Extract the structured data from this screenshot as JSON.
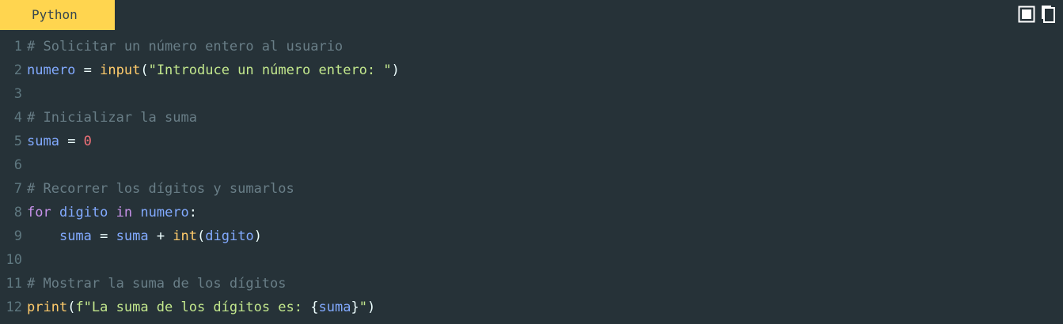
{
  "language_label": "Python",
  "toolbar": {
    "buttons": [
      {
        "name": "toggle-view-icon",
        "label": ""
      },
      {
        "name": "copy-icon",
        "label": ""
      }
    ]
  },
  "colors": {
    "background": "#263238",
    "tab_bg": "#ffd54f",
    "comment": "#697e87",
    "variable": "#82aaff",
    "function": "#ffcb6b",
    "string": "#c3e88d",
    "number": "#f07178",
    "keyword": "#c792ea"
  },
  "code": {
    "lines": [
      {
        "n": "1",
        "tokens": [
          {
            "t": "comment",
            "v": "# Solicitar un número entero al usuario"
          }
        ]
      },
      {
        "n": "2",
        "tokens": [
          {
            "t": "var",
            "v": "numero"
          },
          {
            "t": "op",
            "v": " = "
          },
          {
            "t": "func",
            "v": "input"
          },
          {
            "t": "punc",
            "v": "("
          },
          {
            "t": "str",
            "v": "\"Introduce un número entero: \""
          },
          {
            "t": "punc",
            "v": ")"
          }
        ]
      },
      {
        "n": "3",
        "tokens": []
      },
      {
        "n": "4",
        "tokens": [
          {
            "t": "comment",
            "v": "# Inicializar la suma"
          }
        ]
      },
      {
        "n": "5",
        "tokens": [
          {
            "t": "var",
            "v": "suma"
          },
          {
            "t": "op",
            "v": " = "
          },
          {
            "t": "num",
            "v": "0"
          }
        ]
      },
      {
        "n": "6",
        "tokens": []
      },
      {
        "n": "7",
        "tokens": [
          {
            "t": "comment",
            "v": "# Recorrer los dígitos y sumarlos"
          }
        ]
      },
      {
        "n": "8",
        "tokens": [
          {
            "t": "kw",
            "v": "for"
          },
          {
            "t": "op",
            "v": " "
          },
          {
            "t": "var",
            "v": "digito"
          },
          {
            "t": "op",
            "v": " "
          },
          {
            "t": "kw",
            "v": "in"
          },
          {
            "t": "op",
            "v": " "
          },
          {
            "t": "var",
            "v": "numero"
          },
          {
            "t": "punc",
            "v": ":"
          }
        ]
      },
      {
        "n": "9",
        "tokens": [
          {
            "t": "op",
            "v": "    "
          },
          {
            "t": "var",
            "v": "suma"
          },
          {
            "t": "op",
            "v": " = "
          },
          {
            "t": "var",
            "v": "suma"
          },
          {
            "t": "op",
            "v": " + "
          },
          {
            "t": "func",
            "v": "int"
          },
          {
            "t": "punc",
            "v": "("
          },
          {
            "t": "var",
            "v": "digito"
          },
          {
            "t": "punc",
            "v": ")"
          }
        ]
      },
      {
        "n": "10",
        "tokens": []
      },
      {
        "n": "11",
        "tokens": [
          {
            "t": "comment",
            "v": "# Mostrar la suma de los dígitos"
          }
        ]
      },
      {
        "n": "12",
        "tokens": [
          {
            "t": "func",
            "v": "print"
          },
          {
            "t": "punc",
            "v": "("
          },
          {
            "t": "str",
            "v": "f\"La suma de los dígitos es: "
          },
          {
            "t": "punc",
            "v": "{"
          },
          {
            "t": "var",
            "v": "suma"
          },
          {
            "t": "punc",
            "v": "}"
          },
          {
            "t": "str",
            "v": "\""
          },
          {
            "t": "punc",
            "v": ")"
          }
        ]
      }
    ]
  }
}
